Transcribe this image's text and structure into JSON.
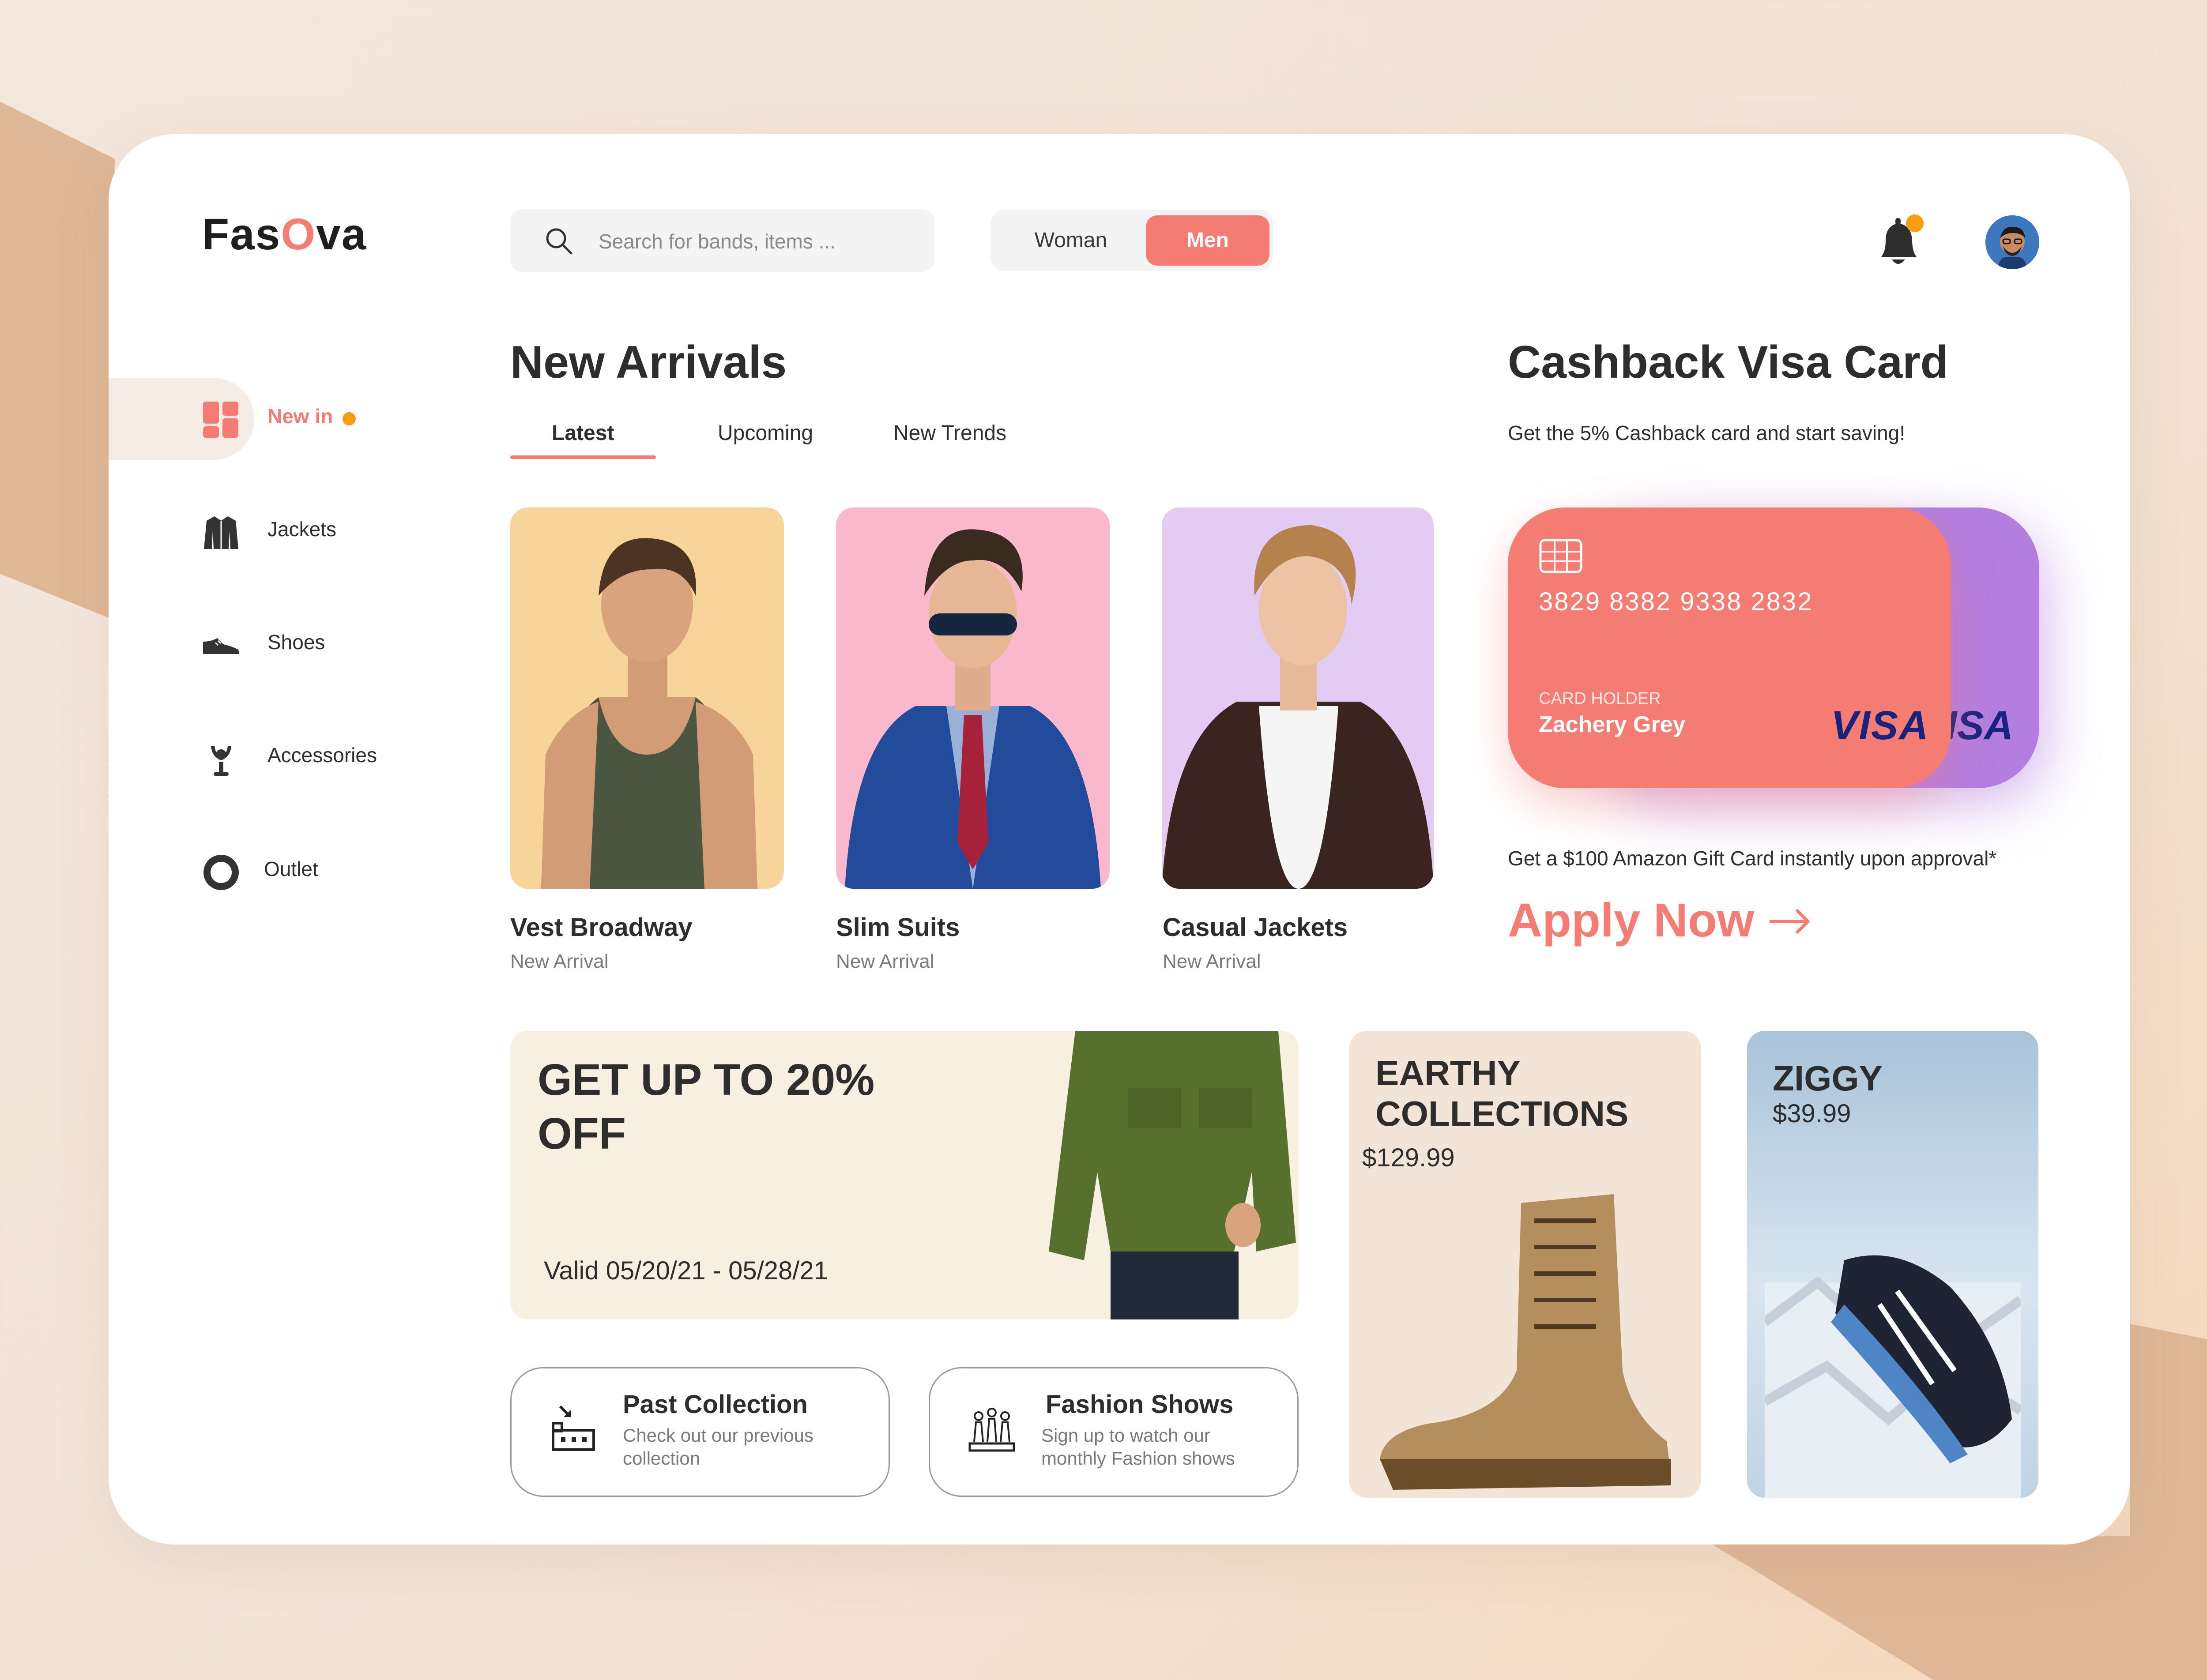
{
  "brand": {
    "logo_prefix": "Fas",
    "logo_o": "O",
    "logo_suffix": "va",
    "accent": "#f47c72"
  },
  "search": {
    "placeholder": "Search for bands, items ..."
  },
  "gender_toggle": {
    "options": [
      "Woman",
      "Men"
    ],
    "selected": "Men"
  },
  "header_icons": {
    "bell": "bell-icon",
    "avatar": "user-avatar"
  },
  "sidebar": {
    "items": [
      {
        "label": "New in",
        "icon": "grid-icon",
        "active": true
      },
      {
        "label": "Jackets",
        "icon": "jacket-icon"
      },
      {
        "label": "Shoes",
        "icon": "shoe-icon"
      },
      {
        "label": "Accessories",
        "icon": "necklace-icon"
      },
      {
        "label": "Outlet",
        "icon": "outlet-ring-icon"
      }
    ]
  },
  "arrivals": {
    "title": "New Arrivals",
    "tabs": [
      "Latest",
      "Upcoming",
      "New Trends"
    ],
    "selected_tab": "Latest",
    "products": [
      {
        "name": "Vest Broadway",
        "sub": "New Arrival",
        "bg": "#f7d59a"
      },
      {
        "name": "Slim Suits",
        "sub": "New Arrival",
        "bg": "#f9b8cc"
      },
      {
        "name": "Casual Jackets",
        "sub": "New Arrival",
        "bg": "#e3cbf3"
      }
    ]
  },
  "promo": {
    "title": "GET UP TO 20% OFF",
    "validity": "Valid 05/20/21 - 05/28/21"
  },
  "links": [
    {
      "title": "Past Collection",
      "sub": "Check out our previous collection",
      "icon": "collection-icon"
    },
    {
      "title": "Fashion Shows",
      "sub": "Sign up to watch our monthly Fashion shows",
      "icon": "fashion-show-icon"
    }
  ],
  "earthy": {
    "title": "EARTHY COLLECTIONS",
    "price": "$129.99"
  },
  "ziggy": {
    "title": "ZIGGY",
    "price": "$39.99"
  },
  "cashback": {
    "title": "Cashback Visa Card",
    "subtitle": "Get the 5% Cashback card and start saving!",
    "card_number": "3829 8382 9338 2832",
    "holder_label": "CARD HOLDER",
    "holder_name": "Zachery Grey",
    "network": "VISA",
    "network_back_partial": "ISA",
    "gift": "Get a $100 Amazon Gift Card instantly upon approval*",
    "cta": "Apply Now"
  }
}
